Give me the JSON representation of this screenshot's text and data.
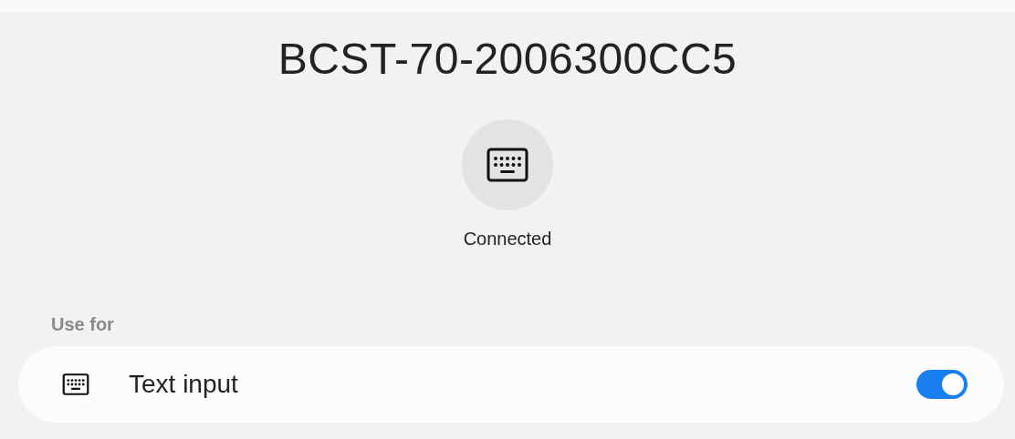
{
  "device": {
    "name": "BCST-70-2006300CC5",
    "status": "Connected"
  },
  "use_for": {
    "heading": "Use for",
    "items": [
      {
        "label": "Text input",
        "on": true
      }
    ]
  }
}
